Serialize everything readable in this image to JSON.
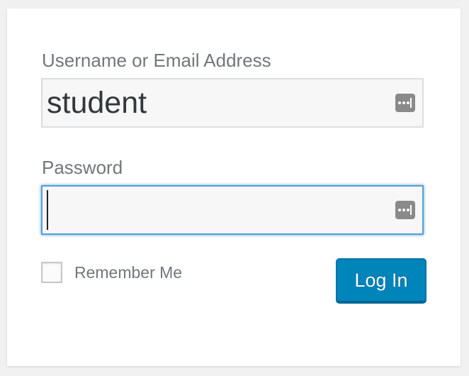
{
  "login_form": {
    "username_label": "Username or Email Address",
    "username_value": "student",
    "password_label": "Password",
    "password_value": "",
    "remember_label": "Remember Me",
    "remember_checked": false,
    "login_button_label": "Log In"
  },
  "icons": {
    "password_manager": "password-manager-icon"
  },
  "colors": {
    "accent": "#0085ba",
    "focus_border": "#5b9dd9",
    "label_text": "#72777c",
    "page_background": "#f1f1f1"
  }
}
